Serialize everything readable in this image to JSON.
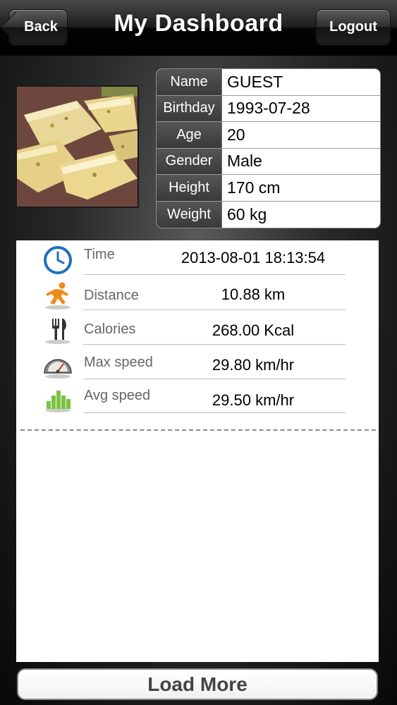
{
  "navbar": {
    "title": "My Dashboard",
    "back_label": "Back",
    "logout_label": "Logout"
  },
  "profile": {
    "rows": [
      {
        "label": "Name",
        "value": "GUEST"
      },
      {
        "label": "Birthday",
        "value": "1993-07-28"
      },
      {
        "label": "Age",
        "value": "20"
      },
      {
        "label": "Gender",
        "value": "Male"
      },
      {
        "label": "Height",
        "value": "170 cm"
      },
      {
        "label": "Weight",
        "value": "60 kg"
      }
    ]
  },
  "stats": [
    {
      "icon": "clock-icon",
      "label": "Time",
      "value": "2013-08-01 18:13:54"
    },
    {
      "icon": "runner-icon",
      "label": "Distance",
      "value": "10.88 km"
    },
    {
      "icon": "fork-knife-icon",
      "label": "Calories",
      "value": "268.00 Kcal"
    },
    {
      "icon": "speedometer-icon",
      "label": "Max speed",
      "value": "29.80 km/hr"
    },
    {
      "icon": "bar-chart-icon",
      "label": "Avg speed",
      "value": "29.50 km/hr"
    }
  ],
  "load_more_label": "Load More",
  "colors": {
    "clock_blue": "#1f6fc0",
    "runner_orange": "#f08a1c",
    "bars_green": "#7cc242"
  }
}
